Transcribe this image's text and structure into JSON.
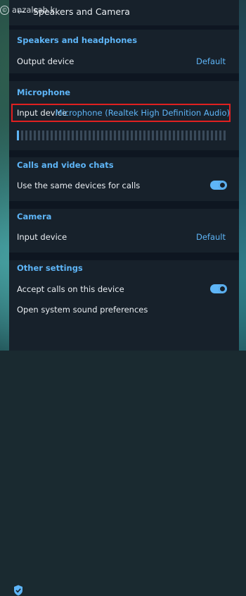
{
  "watermark": "anzalsab.k",
  "header": {
    "title": "Speakers and Camera"
  },
  "speakers": {
    "title": "Speakers and headphones",
    "output_label": "Output device",
    "output_value": "Default"
  },
  "microphone": {
    "title": "Microphone",
    "input_label": "Input device",
    "input_value": "Microphone (Realtek High Definition Audio)",
    "level_active_bars": 1,
    "level_total_bars": 50
  },
  "calls": {
    "title": "Calls and video chats",
    "same_devices_label": "Use the same devices for calls",
    "same_devices_on": true
  },
  "camera": {
    "title": "Camera",
    "input_label": "Input device",
    "input_value": "Default"
  },
  "other": {
    "title": "Other settings",
    "accept_calls_label": "Accept calls on this device",
    "accept_calls_on": true,
    "sound_prefs_label": "Open system sound preferences"
  },
  "colors": {
    "accent": "#5eb5f7",
    "panel": "#17212b",
    "separator": "#0e1621",
    "highlight": "#e02020"
  },
  "icons": {
    "back": "back-arrow-icon",
    "shield": "shield-icon"
  }
}
